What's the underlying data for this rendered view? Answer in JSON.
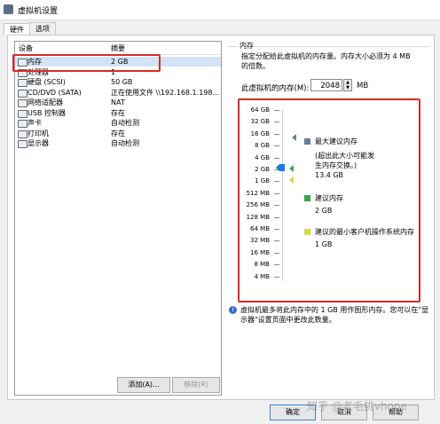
{
  "window": {
    "title": "虚拟机设置"
  },
  "tabs": [
    {
      "label": "硬件"
    },
    {
      "label": "选项"
    }
  ],
  "device_list": {
    "col_device": "设备",
    "col_summary": "摘要",
    "rows": [
      {
        "name": "内存",
        "summary": "2 GB",
        "icon": "memory-icon"
      },
      {
        "name": "处理器",
        "summary": "1",
        "icon": "cpu-icon"
      },
      {
        "name": "硬盘 (SCSI)",
        "summary": "50 GB",
        "icon": "disk-icon"
      },
      {
        "name": "CD/DVD (SATA)",
        "summary": "正在使用文件 \\\\192.168.1.198...",
        "icon": "cd-icon"
      },
      {
        "name": "网络适配器",
        "summary": "NAT",
        "icon": "network-icon"
      },
      {
        "name": "USB 控制器",
        "summary": "存在",
        "icon": "usb-icon"
      },
      {
        "name": "声卡",
        "summary": "自动检测",
        "icon": "sound-icon"
      },
      {
        "name": "打印机",
        "summary": "存在",
        "icon": "printer-icon"
      },
      {
        "name": "显示器",
        "summary": "自动检测",
        "icon": "display-icon"
      }
    ]
  },
  "buttons": {
    "add": "添加(A)...",
    "remove": "移除(R)",
    "ok": "确定",
    "cancel": "取消",
    "help": "帮助"
  },
  "memory": {
    "group_title": "内存",
    "description": "指定分配给此虚拟机的内存量。内存大小必须为 4 MB 的倍数。",
    "field_label": "此虚拟机的内存(M):",
    "value": "2048",
    "unit": "MB",
    "scale": [
      "64 GB",
      "32 GB",
      "16 GB",
      "8 GB",
      "4 GB",
      "2 GB",
      "1 GB",
      "512 MB",
      "256 MB",
      "128 MB",
      "64 MB",
      "32 MB",
      "16 MB",
      "8 MB",
      "4 MB"
    ],
    "legend": {
      "max_title": "最大建议内存",
      "max_note": "(超出此大小可能发生内存交换。)",
      "max_value": "13.4 GB",
      "rec_title": "建议内存",
      "rec_value": "2 GB",
      "min_title": "建议的最小客户机操作系统内存",
      "min_value": "1 GB"
    },
    "info_text": "虚拟机最多将此内存中的 1 GB 用作图形内存。您可以在\"显示器\"设置页面中更改此数量。"
  },
  "watermark": "知乎 @老毛挑vhope"
}
